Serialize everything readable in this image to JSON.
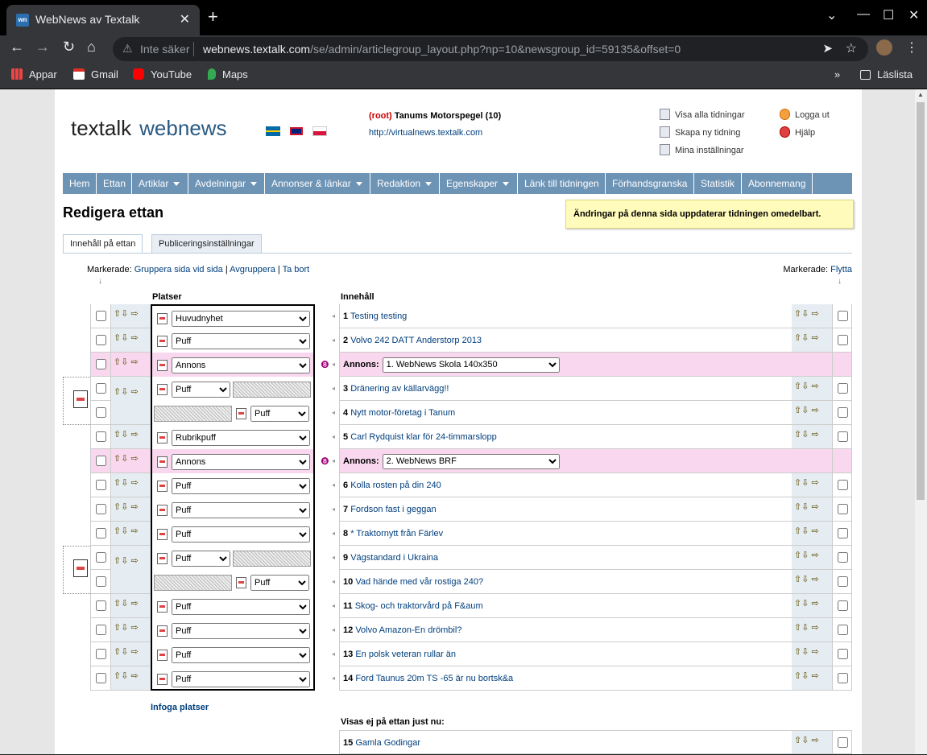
{
  "browser": {
    "tab_title": "WebNews av Textalk",
    "tab_favicon": "wn",
    "security_label": "Inte säker",
    "url_host": "webnews.textalk.com",
    "url_path": "/se/admin/articlegroup_layout.php?np=10&newsgroup_id=59135&offset=0",
    "bookmarks": [
      "Appar",
      "Gmail",
      "YouTube",
      "Maps"
    ],
    "reading_list": "Läslista"
  },
  "header": {
    "logo_text": "textalk",
    "logo_product": "webnews",
    "site_root": "(root)",
    "site_name": "Tanums Motorspegel (10)",
    "site_url": "http://virtualnews.textalk.com",
    "tools": [
      "Visa alla tidningar",
      "Skapa ny tidning",
      "Mina inställningar"
    ],
    "logout": "Logga ut",
    "help": "Hjälp"
  },
  "menu": [
    "Hem",
    "Ettan",
    "Artiklar",
    "Avdelningar",
    "Annonser & länkar",
    "Redaktion",
    "Egenskaper",
    "Länk till tidningen",
    "Förhandsgranska",
    "Statistik",
    "Abonnemang"
  ],
  "page": {
    "title": "Redigera ettan",
    "notice": "Ändringar på denna sida uppdaterar tidningen omedelbart.",
    "tabs": [
      "Innehåll på ettan",
      "Publiceringsinställningar"
    ],
    "marked_label": "Markerade:",
    "marked_actions_left": [
      "Gruppera sida vid sida",
      "Avgruppera",
      "Ta bort"
    ],
    "marked_action_right": "Flytta",
    "col_places": "Platser",
    "col_content": "Innehåll",
    "insert_places": "Infoga platser",
    "not_shown": "Visas ej på ettan just nu:"
  },
  "rows": [
    {
      "type": "Huvudnyhet",
      "num": "1",
      "title": "Testing testing"
    },
    {
      "type": "Puff",
      "num": "2",
      "title": "Volvo 242 DATT Anderstorp 2013"
    },
    {
      "type": "Annons",
      "ad_label": "Annons:",
      "ad_value": "1. WebNews Skola 140x350"
    },
    {
      "type": "Puff",
      "num": "3",
      "title": "Dränering av källarvägg!!"
    },
    {
      "type": "Puff",
      "num": "4",
      "title": "Nytt motor-företag i Tanum"
    },
    {
      "type": "Rubrikpuff",
      "num": "5",
      "title": "Carl Rydquist klar för 24-timmarslopp"
    },
    {
      "type": "Annons",
      "ad_label": "Annons:",
      "ad_value": "2. WebNews BRF"
    },
    {
      "type": "Puff",
      "num": "6",
      "title": "Kolla rosten på din 240"
    },
    {
      "type": "Puff",
      "num": "7",
      "title": "Fordson fast i geggan"
    },
    {
      "type": "Puff",
      "num": "8",
      "title": "* Traktornytt från Färlev"
    },
    {
      "type": "Puff",
      "num": "9",
      "title": "Vägstandard i Ukraina"
    },
    {
      "type": "Puff",
      "num": "10",
      "title": "Vad hände med vår rostiga 240?"
    },
    {
      "type": "Puff",
      "num": "11",
      "title": "Skog- och traktorvård på F&aum"
    },
    {
      "type": "Puff",
      "num": "12",
      "title": "Volvo Amazon-En drömbil?"
    },
    {
      "type": "Puff",
      "num": "13",
      "title": "En polsk veteran rullar än"
    },
    {
      "type": "Puff",
      "num": "14",
      "title": "Ford Taunus 20m TS -65 är nu bortsk&a"
    }
  ],
  "hidden_rows": [
    {
      "num": "15",
      "title": "Gamla Godingar"
    }
  ],
  "icons": {
    "arrows": "up-down-move-icons",
    "ad": "ad-icon",
    "group": "group-icon"
  }
}
